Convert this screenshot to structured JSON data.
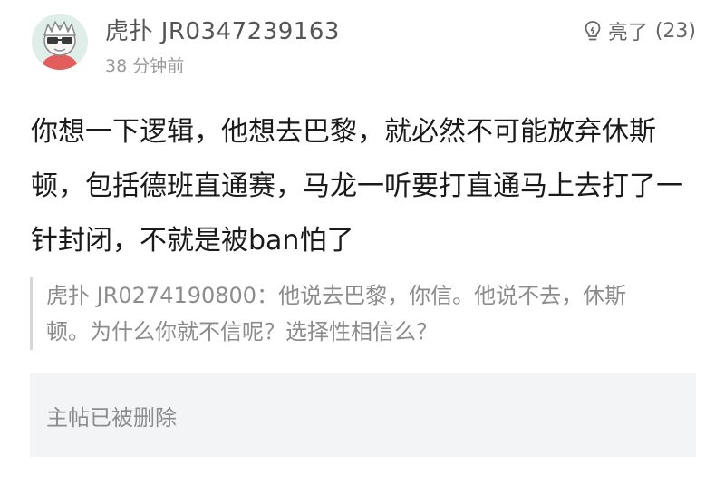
{
  "header": {
    "username": "虎扑 JR0347239163",
    "timestamp": "38 分钟前",
    "light_label": "亮了",
    "light_count": "(23)",
    "avatar_icon": "cartoon-face-avatar-icon",
    "light_icon": "lightbulb-icon"
  },
  "comment": {
    "text": "你想一下逻辑，他想去巴黎，就必然不可能放弃休斯顿，包括德班直通赛，马龙一听要打直通马上去打了一针封闭，不就是被ban怕了"
  },
  "quote": {
    "author": "虎扑 JR0274190800：",
    "text": "他说去巴黎，你信。他说不去，休斯顿。为什么你就不信呢？选择性相信么？"
  },
  "main_post": {
    "status": "主帖已被删除"
  },
  "colors": {
    "avatar_bg": "#dfeee8",
    "quote_bar": "#d7d7d7",
    "deleted_bg": "#f3f4f6"
  }
}
